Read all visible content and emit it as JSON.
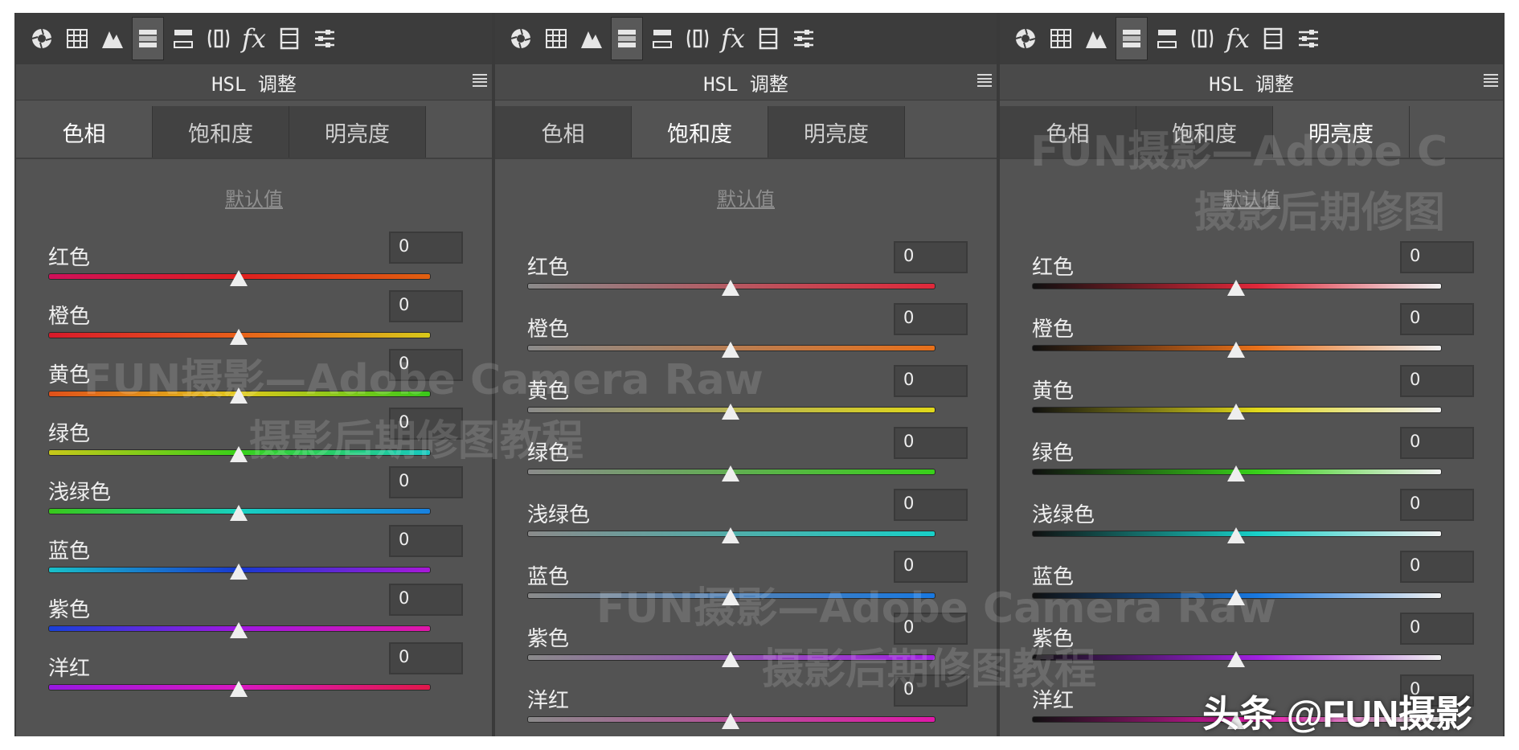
{
  "panels": [
    {
      "title": "HSL 调整",
      "tabs": [
        "色相",
        "饱和度",
        "明亮度"
      ],
      "active_tab": 0,
      "defaults_label": "默认值",
      "sliders": [
        {
          "label": "红色",
          "value": "0"
        },
        {
          "label": "橙色",
          "value": "0"
        },
        {
          "label": "黄色",
          "value": "0"
        },
        {
          "label": "绿色",
          "value": "0"
        },
        {
          "label": "浅绿色",
          "value": "0"
        },
        {
          "label": "蓝色",
          "value": "0"
        },
        {
          "label": "紫色",
          "value": "0"
        },
        {
          "label": "洋红",
          "value": "0"
        }
      ]
    },
    {
      "title": "HSL 调整",
      "tabs": [
        "色相",
        "饱和度",
        "明亮度"
      ],
      "active_tab": 1,
      "defaults_label": "默认值",
      "sliders": [
        {
          "label": "红色",
          "value": "0"
        },
        {
          "label": "橙色",
          "value": "0"
        },
        {
          "label": "黄色",
          "value": "0"
        },
        {
          "label": "绿色",
          "value": "0"
        },
        {
          "label": "浅绿色",
          "value": "0"
        },
        {
          "label": "蓝色",
          "value": "0"
        },
        {
          "label": "紫色",
          "value": "0"
        },
        {
          "label": "洋红",
          "value": "0"
        }
      ]
    },
    {
      "title": "HSL 调整",
      "tabs": [
        "色相",
        "饱和度",
        "明亮度"
      ],
      "active_tab": 2,
      "defaults_label": "默认值",
      "sliders": [
        {
          "label": "红色",
          "value": "0"
        },
        {
          "label": "橙色",
          "value": "0"
        },
        {
          "label": "黄色",
          "value": "0"
        },
        {
          "label": "绿色",
          "value": "0"
        },
        {
          "label": "浅绿色",
          "value": "0"
        },
        {
          "label": "蓝色",
          "value": "0"
        },
        {
          "label": "紫色",
          "value": "0"
        },
        {
          "label": "洋红",
          "value": "0"
        }
      ]
    }
  ],
  "toolbar_icons": [
    "aperture-icon",
    "grid-icon",
    "mountain-icon",
    "hsl-icon",
    "split-tone-icon",
    "lens-icon",
    "fx-icon",
    "calibration-icon",
    "presets-icon"
  ],
  "toolbar_fx_label": "fx",
  "hue_gradients": [
    "linear-gradient(90deg,#d0105a,#e01f1f 50%,#e06010)",
    "linear-gradient(90deg,#d81a2a,#e8601a 50%,#d8c81a)",
    "linear-gradient(90deg,#e0501a,#e0c81a 50%,#38c81a)",
    "linear-gradient(90deg,#c8c81a,#38d01a 50%,#18c8c0)",
    "linear-gradient(90deg,#38c81a,#18d0c0 50%,#1880e0)",
    "linear-gradient(90deg,#18c0c8,#1838d0 50%,#a818d8)",
    "linear-gradient(90deg,#1840d8,#a018e0 50%,#e018a8)",
    "linear-gradient(90deg,#9818e0,#d818c0 50%,#e0184a)"
  ],
  "sat_colors": [
    "#e0283a",
    "#e8701a",
    "#e0d81a",
    "#38d01a",
    "#18d0c8",
    "#1878e0",
    "#a020e0",
    "#e018a8"
  ],
  "watermark": {
    "line1": "FUN摄影—Adobe Camera Raw",
    "line2": "摄影后期修图教程",
    "line1_right": "FUN摄影—Adobe C",
    "line2_right": "摄影后期修图"
  },
  "credit": "头条 @FUN摄影"
}
